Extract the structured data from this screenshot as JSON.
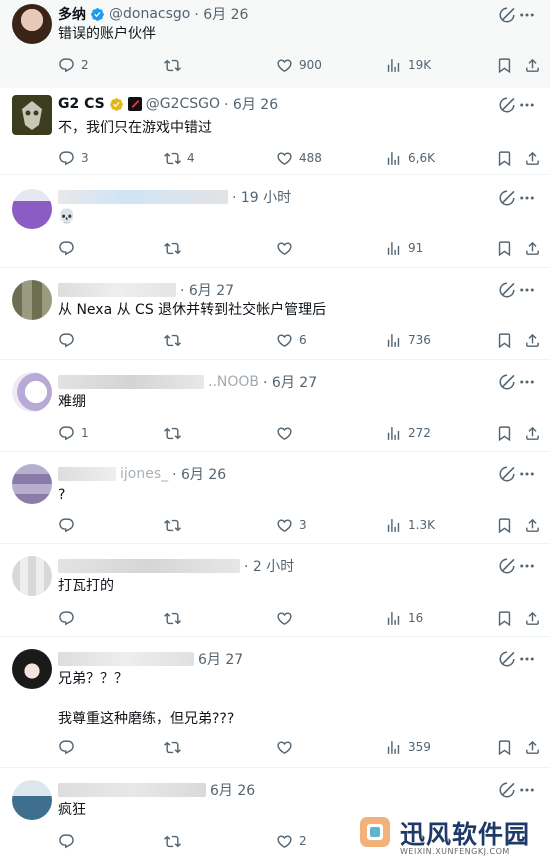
{
  "tweets": [
    {
      "name": "多纳",
      "handle": "@donacsgo",
      "date": "· 6月 26",
      "text": "错误的账户伙伴",
      "replies": "2",
      "retweets": "",
      "likes": "900",
      "views": "19K",
      "verified": "blue"
    },
    {
      "name": "G2 CS",
      "handle": "@G2CSGO",
      "date": "· 6月 26",
      "text": "不，我们只在游戏中错过",
      "replies": "3",
      "retweets": "4",
      "likes": "488",
      "views": "6,6K",
      "verified": "gold"
    },
    {
      "name": "",
      "handle": "",
      "date": "· 19 小时",
      "text": "💀",
      "replies": "",
      "retweets": "",
      "likes": "",
      "views": "91"
    },
    {
      "name": "",
      "handle": "",
      "date": "· 6月 27",
      "text": "从 Nexa 从 CS 退休并转到社交帐户管理后",
      "replies": "",
      "retweets": "",
      "likes": "6",
      "views": "736"
    },
    {
      "name": "",
      "handle": "..NOOB",
      "date": "· 6月 27",
      "text": "难绷",
      "replies": "1",
      "retweets": "",
      "likes": "",
      "views": "272"
    },
    {
      "name": "",
      "handle": "ijones_",
      "date": "· 6月 26",
      "text": "?",
      "replies": "",
      "retweets": "",
      "likes": "3",
      "views": "1.3K"
    },
    {
      "name": "",
      "handle": "",
      "date": "· 2 小时",
      "text": "打瓦打的",
      "replies": "",
      "retweets": "",
      "likes": "",
      "views": "16"
    },
    {
      "name": "",
      "handle": "",
      "date": "6月 27",
      "text": "兄弟？？？\n\n我尊重这种磨练，但兄弟???",
      "replies": "",
      "retweets": "",
      "likes": "",
      "views": "359"
    },
    {
      "name": "",
      "handle": "",
      "date": "6月 26",
      "text": "疯狂",
      "replies": "",
      "retweets": "",
      "likes": "2",
      "views": ""
    }
  ],
  "watermark": {
    "title": "迅风软件园",
    "url": "WEIXIN.XUNFENGKJ.COM"
  },
  "colors": {
    "text": "#0f1419",
    "muted": "#536471",
    "verified_blue": "#1d9bf0",
    "verified_gold": "#e2b719",
    "watermark": "#1f3a68"
  }
}
